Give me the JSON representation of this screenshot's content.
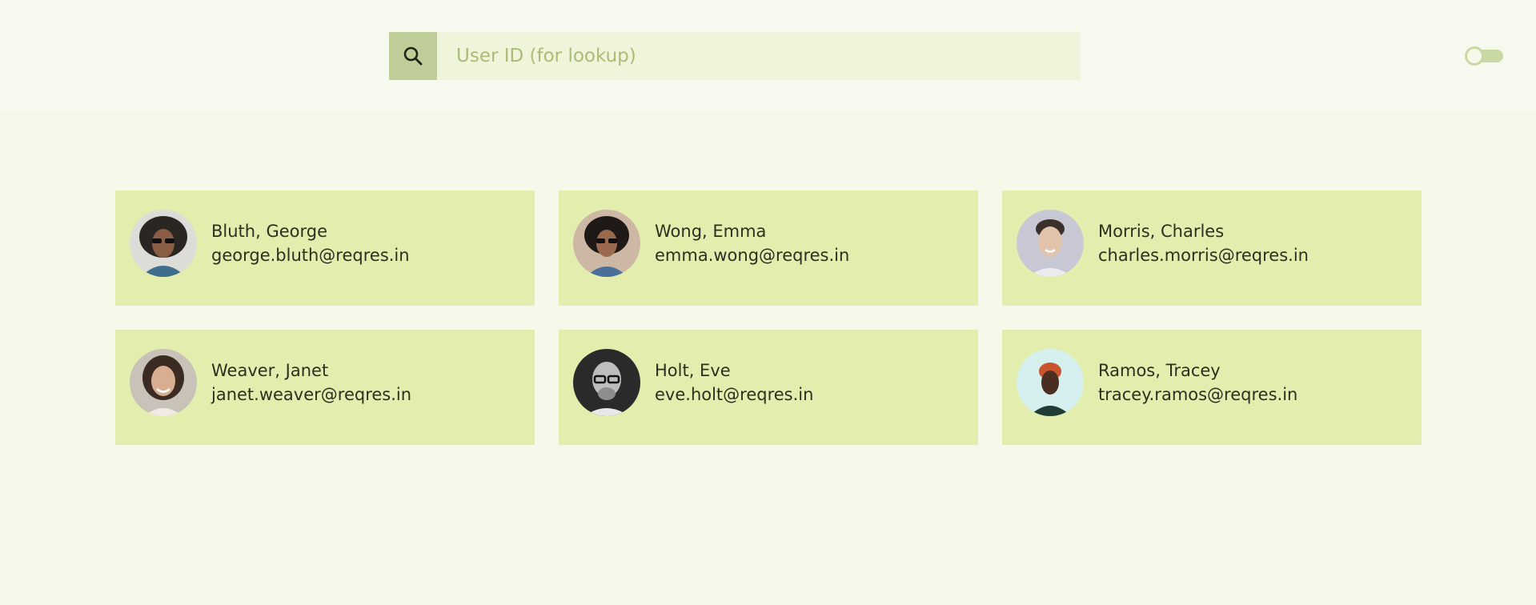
{
  "search": {
    "placeholder": "User ID (for lookup)",
    "value": "",
    "icon": "search-icon"
  },
  "theme_toggle": {
    "state": "off",
    "icon": "toggle-switch"
  },
  "colors": {
    "background": "#f6f8ea",
    "card": "#e2edae",
    "search_button": "#bfcd98",
    "search_field": "#f0f4db",
    "placeholder": "#a9bd74",
    "text": "#2c2f22"
  },
  "users": [
    {
      "name": "Bluth, George",
      "email": "george.bluth@reqres.in",
      "avatar": "avatar-photo"
    },
    {
      "name": "Wong, Emma",
      "email": "emma.wong@reqres.in",
      "avatar": "avatar-photo"
    },
    {
      "name": "Morris, Charles",
      "email": "charles.morris@reqres.in",
      "avatar": "avatar-photo"
    },
    {
      "name": "Weaver, Janet",
      "email": "janet.weaver@reqres.in",
      "avatar": "avatar-photo"
    },
    {
      "name": "Holt, Eve",
      "email": "eve.holt@reqres.in",
      "avatar": "avatar-photo"
    },
    {
      "name": "Ramos, Tracey",
      "email": "tracey.ramos@reqres.in",
      "avatar": "avatar-photo"
    }
  ]
}
